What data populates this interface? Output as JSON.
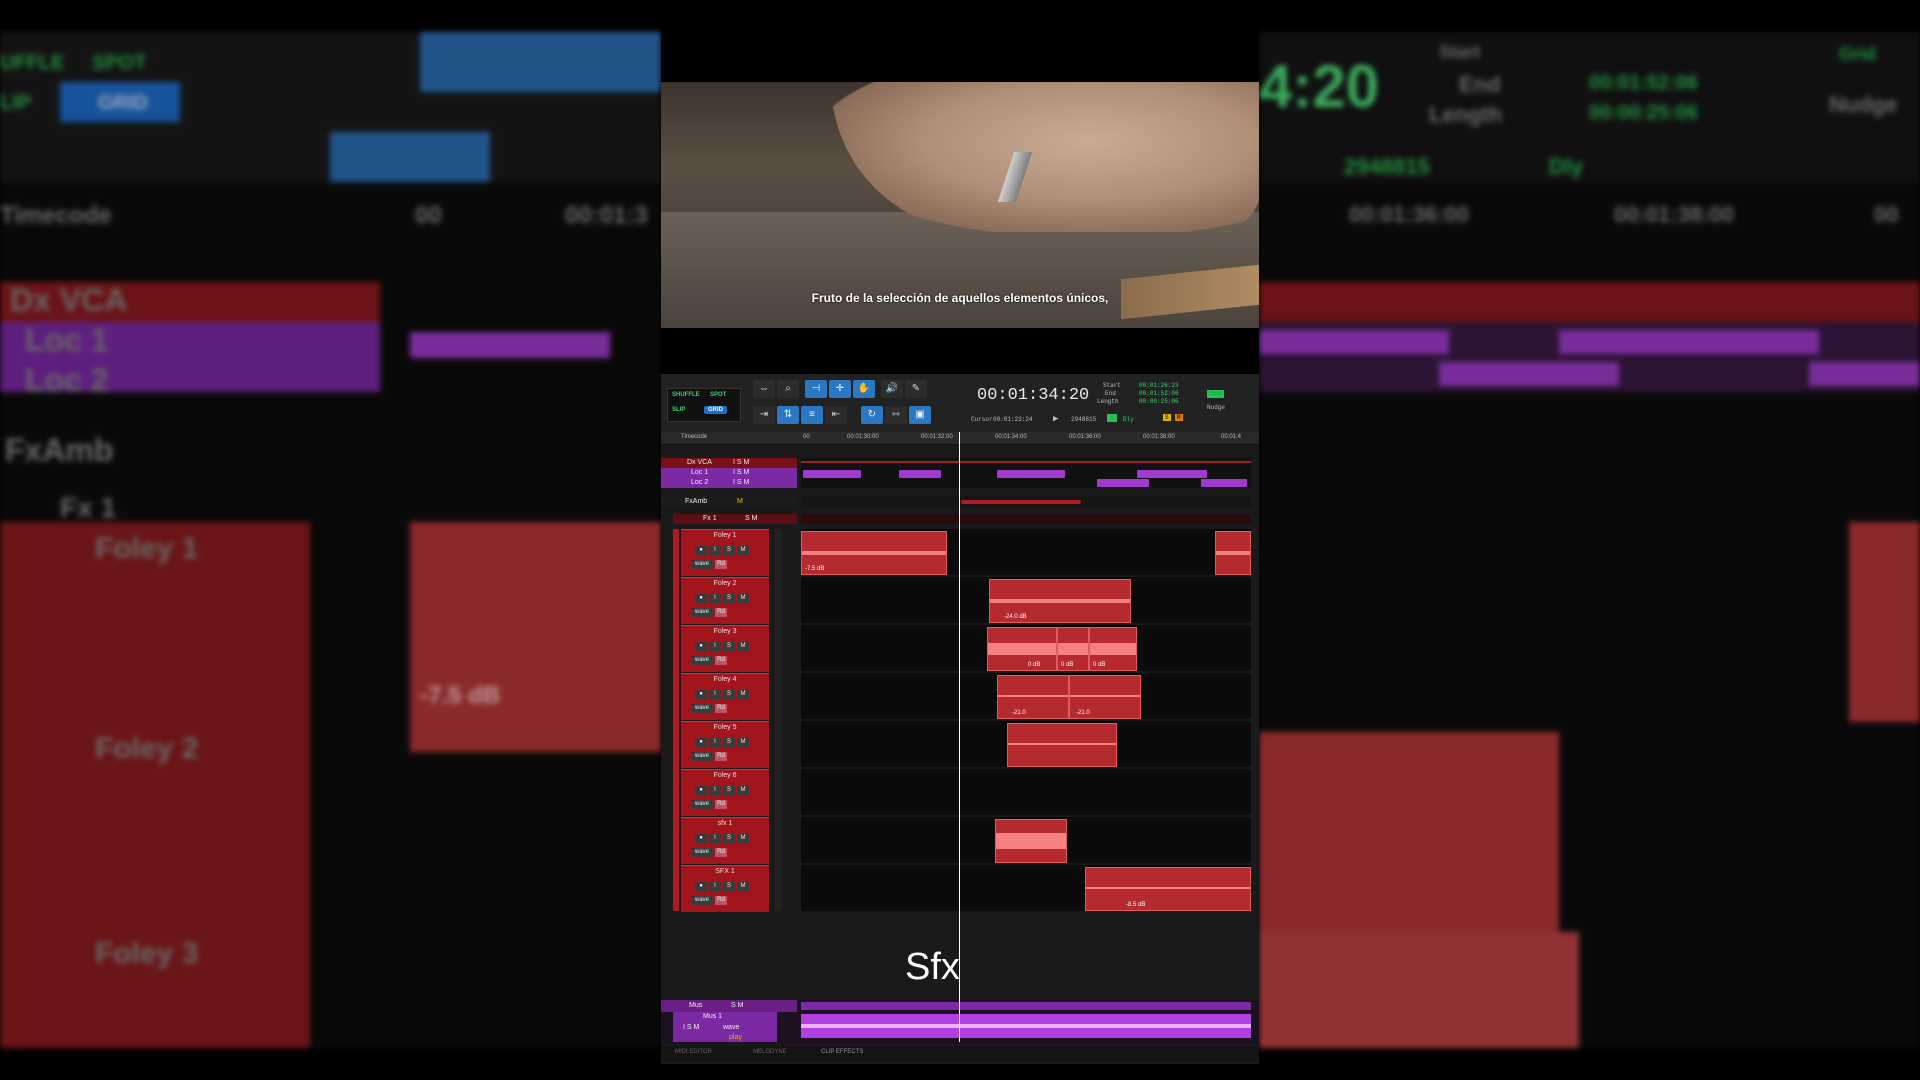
{
  "video": {
    "subtitle": "Fruto de la selección de aquellos elementos únicos,"
  },
  "toolbar": {
    "modes": {
      "shuffle": "SHUFFLE",
      "spot": "SPOT",
      "slip": "SLIP",
      "grid": "GRID"
    },
    "main_counter": "00:01:34:20",
    "start_label": "Start",
    "end_label": "End",
    "length_label": "Length",
    "start_value": "00:01:26:23",
    "end_value": "00:01:52:06",
    "length_value": "00:00:25:06",
    "cursor_label": "Cursor",
    "cursor_value": "00:01:23:24",
    "sample_value": "2948815",
    "dly_label": "Dly",
    "nudge_label": "Nudge",
    "grid_badge": "Grid"
  },
  "ruler": {
    "label": "Timecode",
    "ticks": [
      "00",
      "00:01:30:00",
      "00:01:32:00",
      "00:01:34:00",
      "00:01:36:00",
      "00:01:38:00",
      "00:01:4"
    ]
  },
  "tracks": {
    "top": [
      {
        "name": "Dx VCA",
        "buttons": "I S M"
      },
      {
        "name": "Loc 1",
        "buttons": "I S M"
      },
      {
        "name": "Loc 2",
        "buttons": "I S M"
      }
    ],
    "fxamb": {
      "name": "FxAmb",
      "buttons": "M"
    },
    "fx1": {
      "name": "Fx 1",
      "buttons": "S M"
    },
    "foley": [
      {
        "name": "Foley 1",
        "clips": [
          "-7.5 dB"
        ]
      },
      {
        "name": "Foley 2",
        "clips": [
          "-24.0 dB"
        ]
      },
      {
        "name": "Foley 3",
        "clips": [
          "0 dB",
          "0 dB",
          "0 dB"
        ]
      },
      {
        "name": "Foley 4",
        "clips": [
          "-21.0",
          "-21.0"
        ]
      },
      {
        "name": "Foley 5",
        "clips": []
      },
      {
        "name": "Foley 6",
        "clips": []
      },
      {
        "name": "sfx 1",
        "clips": []
      },
      {
        "name": "SFX 1",
        "clips": [
          "-8.5 dB"
        ]
      }
    ],
    "track_buttons": {
      "record": "●",
      "input": "I",
      "solo": "S",
      "mute": "M",
      "waveform": "wave",
      "read": "Rd"
    },
    "mus": {
      "name": "Mus",
      "buttons": "S M"
    },
    "mus1": {
      "name": "Mus 1",
      "buttons": "I S M",
      "mode": "wave",
      "playlist": "play"
    }
  },
  "overlay_label": "Sfx",
  "bottom_tabs": [
    "MIDI EDITOR",
    "MELODYNE",
    "CLIP EFFECTS"
  ],
  "background": {
    "left_texts": [
      "UFFLE",
      "SPOT",
      "LIP",
      "GRID",
      "Timecode",
      "Dx VCA",
      "Loc 1",
      "Loc 2",
      "FxAmb",
      "Fx 1",
      "Foley 1",
      "Foley 2",
      "Foley 3",
      "-7.5 dB",
      "00",
      "00:01:3"
    ],
    "right_texts": [
      "4:20",
      "Start",
      "End",
      "Length",
      "00:01:52:06",
      "00:00:25:06",
      "2948815",
      "Dly",
      "Grid",
      "Nudge",
      "00:01:36:00",
      "00:01:38:00",
      "00"
    ]
  }
}
